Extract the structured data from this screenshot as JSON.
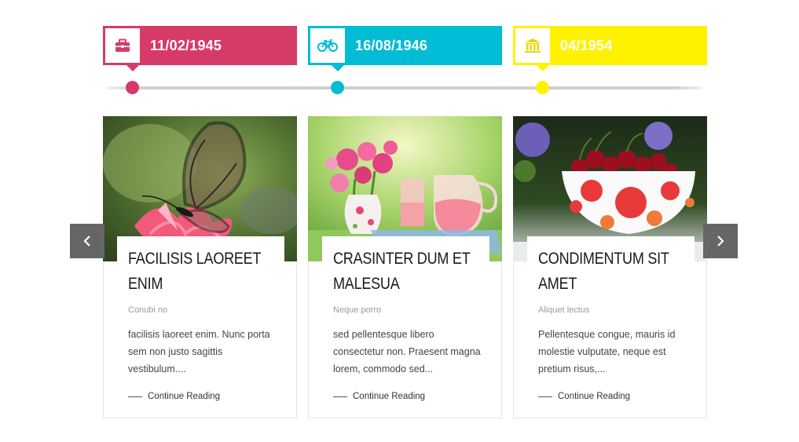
{
  "timeline": {
    "events": [
      {
        "date": "11/02/1945",
        "icon": "briefcase-icon",
        "color": "#d63b67"
      },
      {
        "date": "16/08/1946",
        "icon": "bicycle-icon",
        "color": "#00bcd4"
      },
      {
        "date": "04/1954",
        "icon": "bank-icon",
        "color": "#fff200"
      }
    ]
  },
  "cards": [
    {
      "title": "FACILISIS LAOREET ENIM",
      "author": "Conubi no",
      "excerpt": "facilisis laoreet enim. Nunc porta sem non justo sagittis vestibulum....",
      "more": "Continue Reading",
      "image": "butterfly-on-pink-flower"
    },
    {
      "title": "CRASINTER DUM ET MALESUA",
      "author": "Neque porro",
      "excerpt": "sed pellentesque libero consectetur non. Praesent magna lorem, commodo sed...",
      "more": "Continue Reading",
      "image": "flowers-and-pink-lemonade-pitcher"
    },
    {
      "title": "CONDIMENTUM SIT AMET",
      "author": "Aliquet lectus",
      "excerpt": "Pellentesque congue, mauris id molestie vulputate, neque est pretium risus,...",
      "more": "Continue Reading",
      "image": "bowl-of-cherries"
    }
  ],
  "nav": {
    "prev_icon": "chevron-left-icon",
    "next_icon": "chevron-right-icon"
  }
}
